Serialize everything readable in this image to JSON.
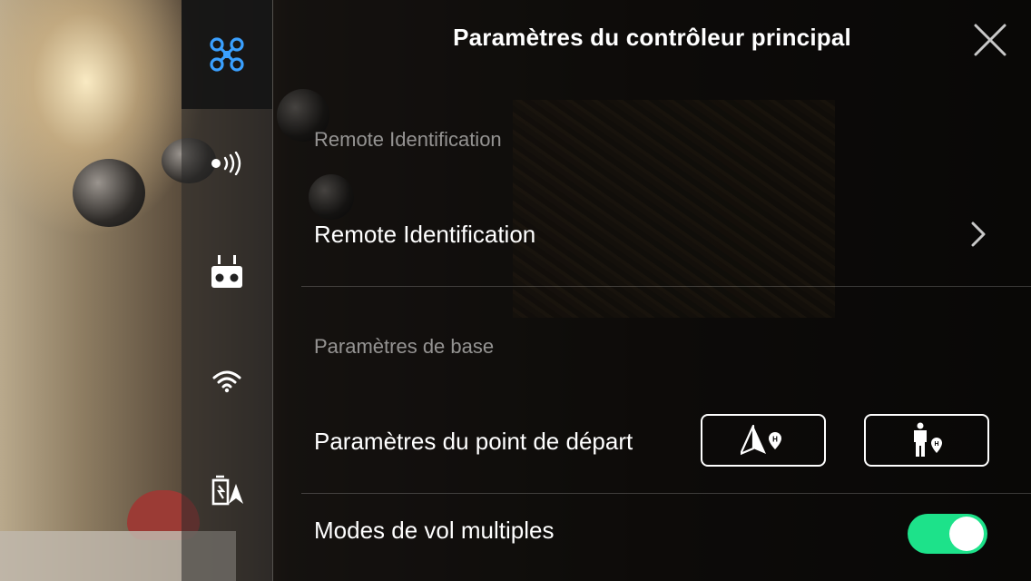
{
  "header": {
    "title": "Paramètres du contrôleur principal"
  },
  "sidebar": {
    "items": [
      {
        "icon": "aircraft-icon",
        "active": true,
        "color": "#3aa0ff"
      },
      {
        "icon": "broadcast-signal-icon",
        "active": false
      },
      {
        "icon": "remote-controller-icon",
        "active": false
      },
      {
        "icon": "wifi-icon",
        "active": false
      },
      {
        "icon": "battery-gps-icon",
        "active": false
      }
    ]
  },
  "sections": {
    "remote_id": {
      "label": "Remote Identification",
      "row_label": "Remote Identification"
    },
    "basic": {
      "label": "Paramètres de base",
      "home_point_label": "Paramètres du point de départ",
      "home_point_options": [
        "aircraft-home-icon",
        "pilot-home-icon"
      ],
      "multi_flight_modes_label": "Modes de vol multiples",
      "multi_flight_modes_enabled": true
    }
  },
  "colors": {
    "accent": "#3aa0ff",
    "toggle_on": "#1de28a"
  }
}
